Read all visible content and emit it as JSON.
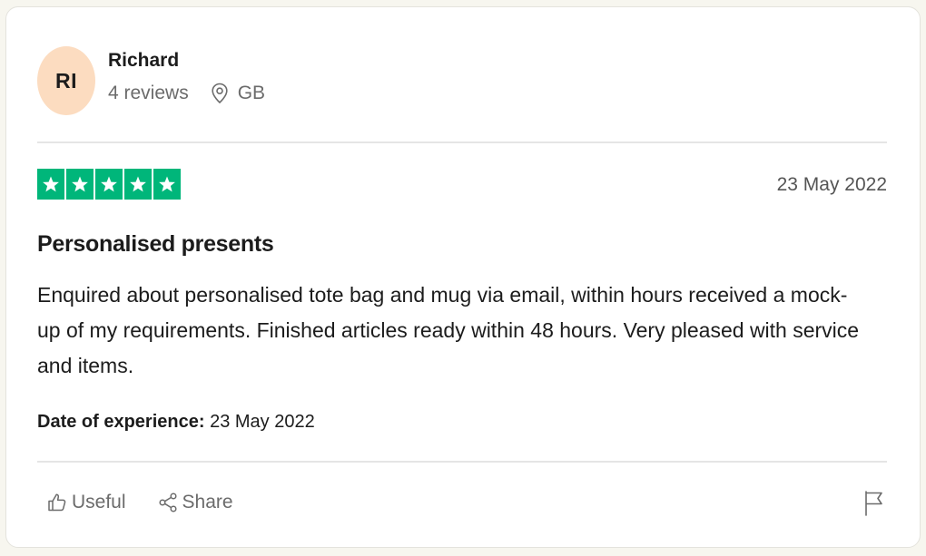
{
  "consumer": {
    "initials": "RI",
    "name": "Richard",
    "reviews_count": "4 reviews",
    "country": "GB"
  },
  "review": {
    "rating": 5,
    "rating_max": 5,
    "date": "23 May 2022",
    "title": "Personalised presents",
    "body": "Enquired about personalised tote bag and mug via email, within hours received a mock-up of my requirements. Finished articles ready within 48 hours. Very pleased with service and items.",
    "experience_label": "Date of experience:",
    "experience_date": "23 May 2022"
  },
  "actions": {
    "useful_label": "Useful",
    "share_label": "Share"
  },
  "icons": {
    "location": "map-pin-icon",
    "useful": "thumbs-up-icon",
    "share": "share-icon",
    "report": "flag-icon",
    "star": "star-icon"
  },
  "colors": {
    "star_green": "#00b67a",
    "avatar_bg": "#fcdcc0",
    "page_bg": "#f7f6ef"
  }
}
